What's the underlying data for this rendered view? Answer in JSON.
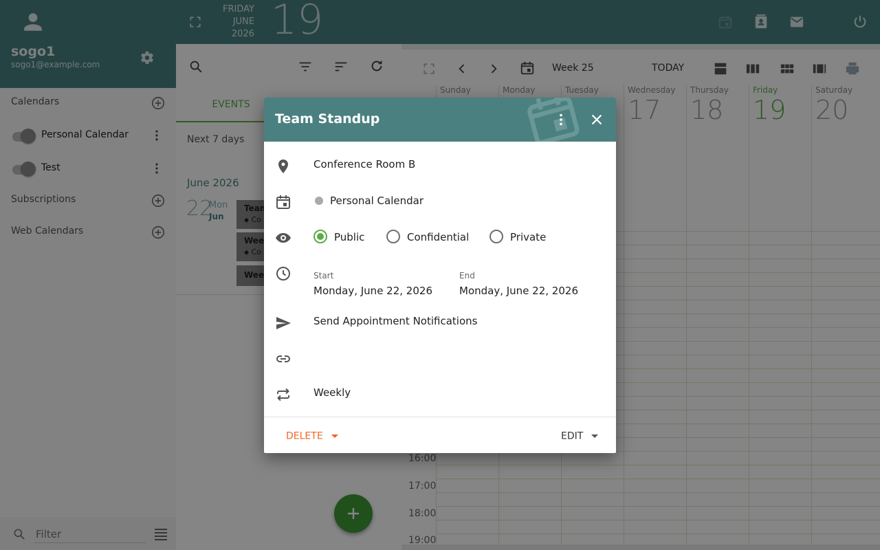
{
  "user": {
    "name": "sogo1",
    "email": "sogo1@example.com"
  },
  "date_header": {
    "weekday": "FRIDAY",
    "month": "JUNE",
    "year": "2026",
    "day": "19"
  },
  "sidebar": {
    "calendars_label": "Calendars",
    "calendars": [
      {
        "name": "Personal Calendar"
      },
      {
        "name": "Test"
      }
    ],
    "subscriptions_label": "Subscriptions",
    "web_calendars_label": "Web Calendars",
    "filter_placeholder": "Filter"
  },
  "list": {
    "tabs": [
      "EVENTS"
    ],
    "filter_value": "Next 7 days",
    "month_heading": "June 2026",
    "day_number": "22",
    "day_weekday": "Mon",
    "day_month": "Jun",
    "events": [
      {
        "title": "Team",
        "location": "Co"
      },
      {
        "title": "Week",
        "location": "Co"
      },
      {
        "title": "Week",
        "location": ""
      }
    ]
  },
  "calendar_toolbar": {
    "week_label": "Week 25",
    "today_label": "TODAY"
  },
  "calendar": {
    "days": [
      {
        "name": "Sunday",
        "num": ""
      },
      {
        "name": "Monday",
        "num": ""
      },
      {
        "name": "Tuesday",
        "num": ""
      },
      {
        "name": "Wednesday",
        "num": "17"
      },
      {
        "name": "Thursday",
        "num": "18"
      },
      {
        "name": "Friday",
        "num": "19"
      },
      {
        "name": "Saturday",
        "num": "20"
      }
    ],
    "hours": [
      "16:00",
      "17:00",
      "18:00",
      "19:00"
    ]
  },
  "dialog": {
    "title": "Team Standup",
    "location": "Conference Room B",
    "calendar": "Personal Calendar",
    "privacy_options": [
      "Public",
      "Confidential",
      "Private"
    ],
    "privacy_selected": "Public",
    "start_label": "Start",
    "start_value": "Monday, June 22, 2026",
    "end_label": "End",
    "end_value": "Monday, June 22, 2026",
    "notifications": "Send Appointment Notifications",
    "repeat": "Weekly",
    "delete_label": "DELETE",
    "edit_label": "EDIT"
  },
  "colors": {
    "teal": "#4a8080",
    "accent_green": "#5aad47",
    "delete_orange": "#f06424",
    "fab_green": "#3f9a36"
  },
  "icons": [
    "account-icon",
    "gear-icon",
    "fullscreen-icon",
    "calendar-app-icon",
    "contacts-icon",
    "mail-icon",
    "power-icon",
    "search-icon",
    "filter-icon",
    "sort-icon",
    "refresh-icon",
    "plus-circle-icon",
    "kebab-icon",
    "chevron-left-icon",
    "chevron-right-icon",
    "calendar-icon",
    "day-view-icon",
    "week-view-icon",
    "month-view-icon",
    "multi-column-icon",
    "print-icon",
    "location-icon",
    "visibility-icon",
    "clock-icon",
    "send-icon",
    "link-icon",
    "repeat-icon",
    "close-icon",
    "dropdown-icon",
    "add-icon",
    "list-icon"
  ]
}
